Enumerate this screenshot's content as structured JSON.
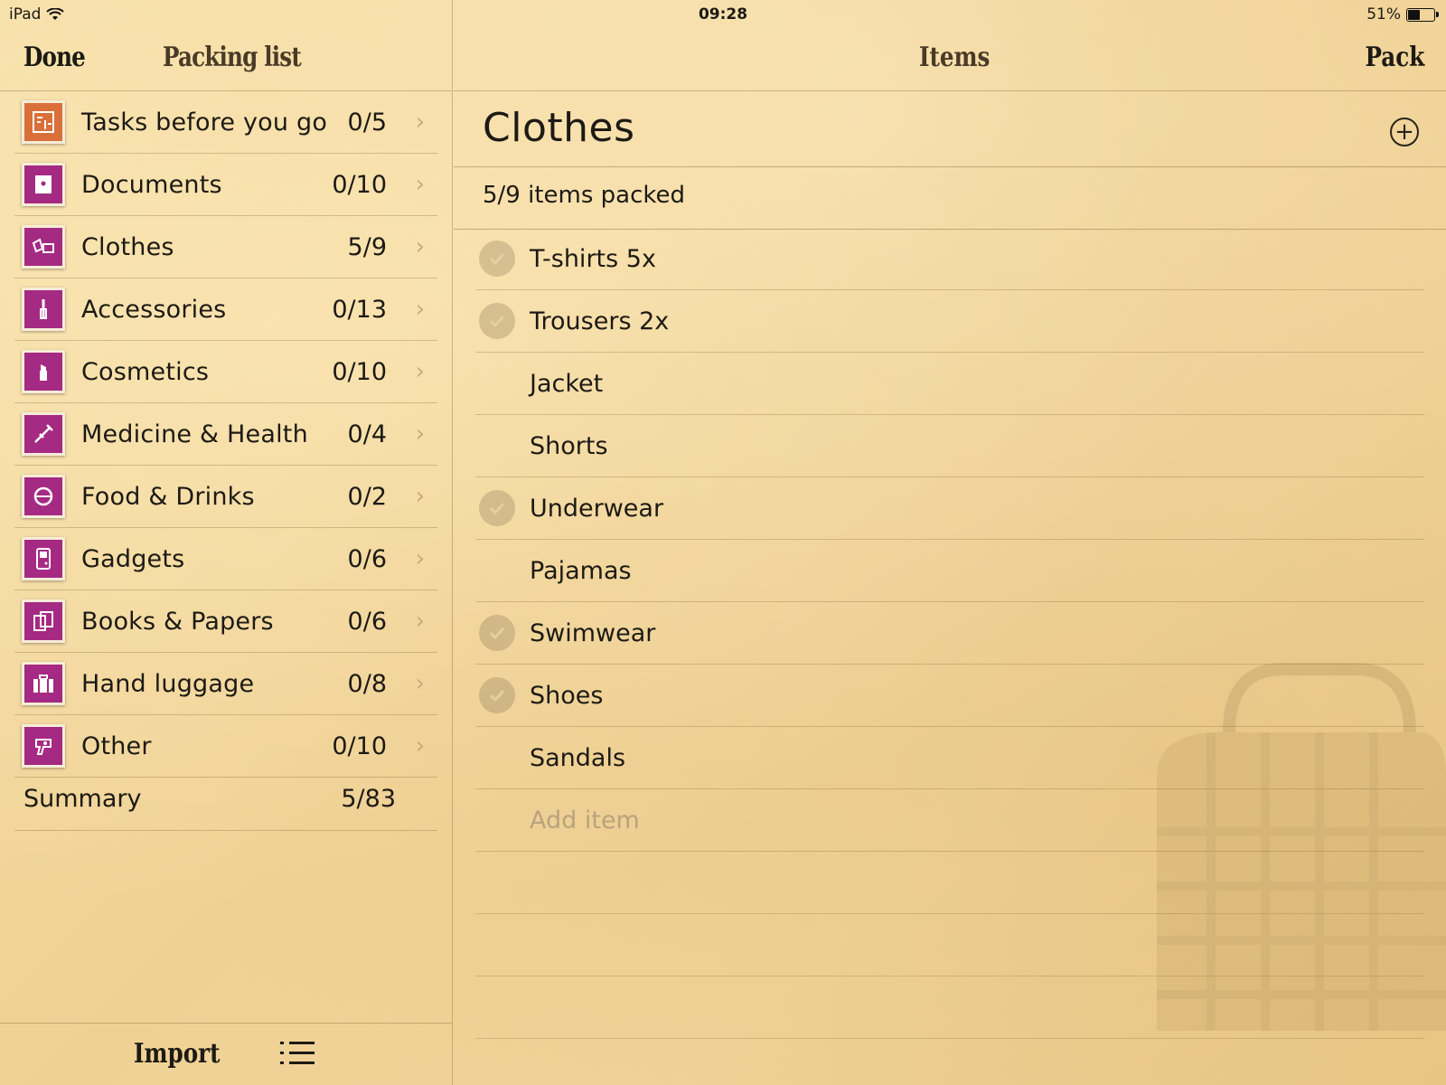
{
  "status_bar": {
    "device": "iPad",
    "time": "09:28",
    "battery": "51%",
    "battery_level": 0.51
  },
  "left_nav": {
    "done_label": "Done",
    "title": "Packing list"
  },
  "categories": [
    {
      "label": "Tasks before you go",
      "count": "0/5",
      "icon": "tasks-icon"
    },
    {
      "label": "Documents",
      "count": "0/10",
      "icon": "documents-icon"
    },
    {
      "label": "Clothes",
      "count": "5/9",
      "icon": "clothes-icon"
    },
    {
      "label": "Accessories",
      "count": "0/13",
      "icon": "accessories-icon"
    },
    {
      "label": "Cosmetics",
      "count": "0/10",
      "icon": "cosmetics-icon"
    },
    {
      "label": "Medicine & Health",
      "count": "0/4",
      "icon": "medicine-icon"
    },
    {
      "label": "Food & Drinks",
      "count": "0/2",
      "icon": "food-icon"
    },
    {
      "label": "Gadgets",
      "count": "0/6",
      "icon": "gadgets-icon"
    },
    {
      "label": "Books & Papers",
      "count": "0/6",
      "icon": "books-icon"
    },
    {
      "label": "Hand luggage",
      "count": "0/8",
      "icon": "hand-luggage-icon"
    },
    {
      "label": "Other",
      "count": "0/10",
      "icon": "other-icon"
    }
  ],
  "summary": {
    "label": "Summary",
    "count": "5/83"
  },
  "bottom_bar": {
    "import_label": "Import"
  },
  "right_nav": {
    "title": "Items",
    "pack_label": "Pack"
  },
  "section": {
    "title": "Clothes",
    "packed_text": "5/9 items packed"
  },
  "items": [
    {
      "label": "T-shirts 5x",
      "packed": true
    },
    {
      "label": "Trousers 2x",
      "packed": true
    },
    {
      "label": "Jacket",
      "packed": false
    },
    {
      "label": "Shorts",
      "packed": false
    },
    {
      "label": "Underwear",
      "packed": true
    },
    {
      "label": "Pajamas",
      "packed": false
    },
    {
      "label": "Swimwear",
      "packed": true
    },
    {
      "label": "Shoes",
      "packed": true
    },
    {
      "label": "Sandals",
      "packed": false
    }
  ],
  "add_item_placeholder": "Add item",
  "colors": {
    "accent_magenta": "#a52a83",
    "accent_orange": "#d9703a",
    "paper": "#f3d9a0"
  }
}
